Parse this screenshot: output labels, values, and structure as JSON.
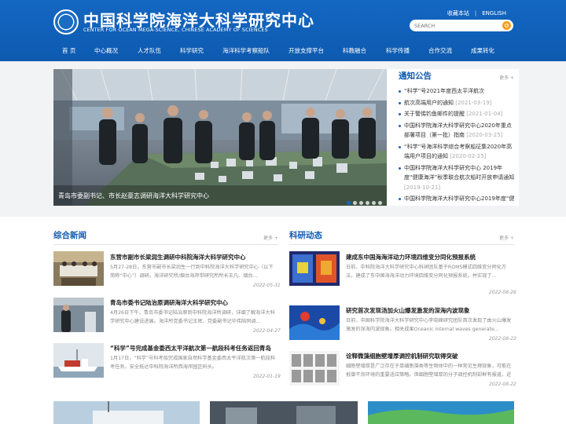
{
  "header": {
    "title": "中国科学院海洋大科学研究中心",
    "subtitle": "CENTER FOR OCEAN MEGA-SCIENCE, CHINESE ACADEMY OF SCIENCES",
    "favorite_link": "收藏本站",
    "lang_link": "ENGLISH",
    "search_placeholder": "SEARCH"
  },
  "nav": [
    "首 页",
    "中心概况",
    "人才队伍",
    "科学研究",
    "海洋科学考察船队",
    "开放支撑平台",
    "科教融合",
    "科学传播",
    "合作交流",
    "成果转化"
  ],
  "banner": {
    "caption": "青岛市委副书记、市长赵豪志调研海洋大科学研究中心",
    "dots": 6,
    "active_dot": 1
  },
  "notice": {
    "title": "通知公告",
    "more": "更多 +",
    "items": [
      {
        "text": "“科学”号2021年度西太平洋航次",
        "date": ""
      },
      {
        "text": "航次高端用户的通知",
        "date": "[2021-03-19]"
      },
      {
        "text": "关于警惕钓鱼邮件的提醒",
        "date": "[2021-01-04]"
      },
      {
        "text": "中国科学院海洋大科学研究中心2020年重点部署项目（第一批）指南",
        "date": "[2020-03-25]"
      },
      {
        "text": "“科学”号海洋科学综合考察船征集2020年高端用户项目的通知",
        "date": "[2020-02-25]"
      },
      {
        "text": "中国科学院海洋大科学研究中心 2019年度“健康海洋”秋季联合航次船时开放申请通知",
        "date": "[2019-10-21]"
      },
      {
        "text": "中国科学院海洋大科学研究中心2019年度“健",
        "date": ""
      }
    ]
  },
  "news": {
    "title": "综合新闻",
    "more": "更多 +",
    "items": [
      {
        "title": "东营市副市长梁润生调研中科院海洋大科学研究中心",
        "summary": "5月27-28日，东营市副市长梁润生一行到中科院海洋大科学研究中心（以下简称“中心”）调研。海洋研究所/烟台海岸带研究所所长王凡、烟台...",
        "date": "2022-05-31"
      },
      {
        "title": "青岛市委书记陆治原调研海洋大科学研究中心",
        "summary": "4月26日下午，青岛市委书记陆治原到中科院海洋所调研，详细了解海洋大科学研究中心建设进展。海洋所党委书记王辉、党委副书记毕伟陪同调...",
        "date": "2022-04-27"
      },
      {
        "title": "“科学”号完成基金委西太平洋航次第一航段科考任务返回青岛",
        "summary": "1月17日，“科学”号科考船完成国家自然科学基金委西太平洋航次第一航段科考任务，安全抵达中科院海洋所西海岸园区码头。",
        "date": "2022-01-19"
      }
    ]
  },
  "research": {
    "title": "科研动态",
    "more": "更多 +",
    "items": [
      {
        "title": "建成东中国海海洋动力环境四维变分同化预报系统",
        "summary": "日前，中科院海洋大科学研究中心科研团队基于ROMS模式四维变分同化方法，建成了东中国海海洋动力环境四维变分同化预报系统，并实现了...",
        "date": "2022-08-26"
      },
      {
        "title": "研究首次发现汤加火山爆发激发的深海内波现象",
        "summary": "日前，中国科学院海洋大科学研究中心李晓峰研究团队首次发现了由火山爆发激发的深海内波现象。相关成果Oceanic internal waves generate...",
        "date": "2022-08-23"
      },
      {
        "title": "诠释微藻细胞壁增厚调控机制研究取得突破",
        "summary": "细胞壁增厚是广泛存在于单细胞藻类等生物体中的一种常见生理现象，可能在抵御不良环境的重要适应策略。但细胞壁增厚的分子调控机制却鲜有报道。近日...",
        "date": "2022-08-22"
      }
    ]
  }
}
